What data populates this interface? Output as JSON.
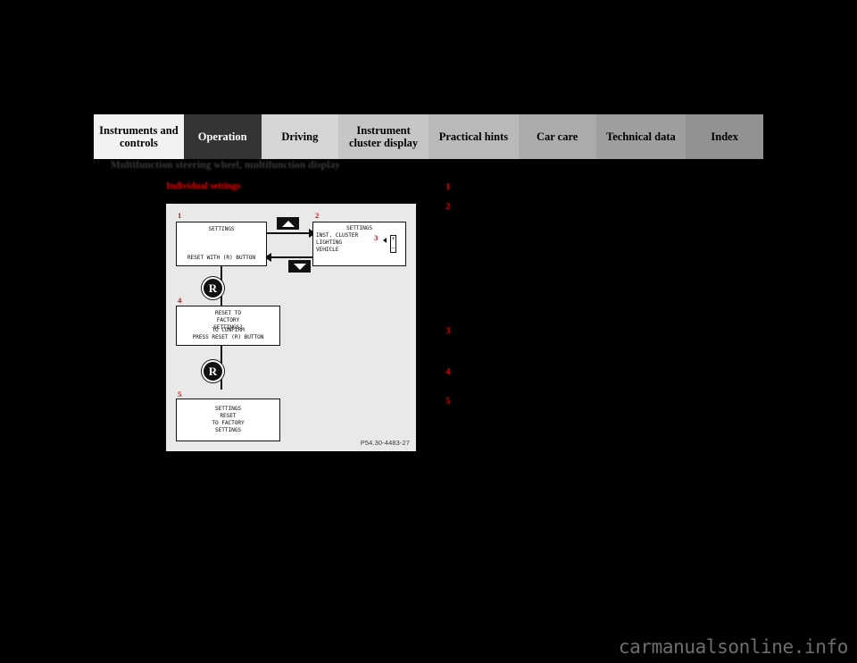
{
  "document": {
    "section_heading": "Multifunction steering wheel, multifunction display",
    "sub_heading": "Individual settings",
    "figure_code": "P54.30-4483-27",
    "watermark": "carmanualsonline.info"
  },
  "tabs": [
    {
      "label": "Instruments\nand controls",
      "bg": "#f2f2f2",
      "active": false
    },
    {
      "label": "Operation",
      "bg": "#343434",
      "active": true
    },
    {
      "label": "Driving",
      "bg": "#d5d5d5",
      "active": false
    },
    {
      "label": "Instrument\ncluster display",
      "bg": "#c6c6c6",
      "active": false
    },
    {
      "label": "Practical hints",
      "bg": "#b9b9b9",
      "active": false
    },
    {
      "label": "Car care",
      "bg": "#ababab",
      "active": false
    },
    {
      "label": "Technical\ndata",
      "bg": "#9e9e9e",
      "active": false
    },
    {
      "label": "Index",
      "bg": "#929292",
      "active": false
    }
  ],
  "callouts": {
    "numbers": [
      "1",
      "2",
      "3",
      "4",
      "5"
    ],
    "tops": [
      203,
      225,
      364,
      410,
      443
    ]
  },
  "figure": {
    "markers": {
      "m1": "1",
      "m2": "2",
      "m3": "3",
      "m4": "4",
      "m5": "5"
    },
    "screen1": {
      "title": "SETTINGS",
      "footer": "RESET WITH (R) BUTTON"
    },
    "screen2": {
      "title": "SETTINGS",
      "items": "INST. CLUSTER\nLIGHTING\nVEHICLE",
      "scroll_up": "+",
      "scroll_down": "–"
    },
    "screen4": {
      "line1": "RESET TO\nFACTORY\nSETTINGS?",
      "line2": "TO CONFIRM\nPRESS RESET (R) BUTTON"
    },
    "screen5": {
      "text": "SETTINGS\nRESET\nTO FACTORY\nSETTINGS"
    },
    "reset_button_label": "R",
    "icons": {
      "up": "chevron-up",
      "down": "chevron-down"
    }
  }
}
